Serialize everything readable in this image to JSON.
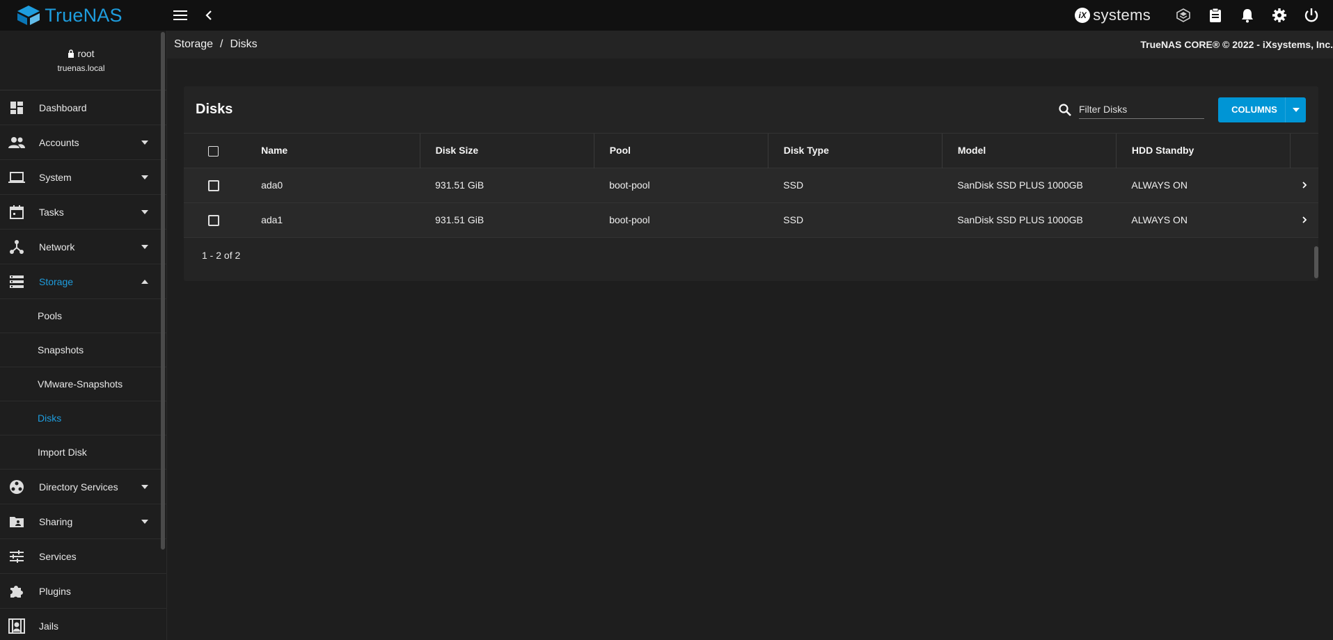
{
  "app": {
    "brand": "TrueNAS",
    "brand_sub": "CORE",
    "vendor": "systems",
    "vendor_badge": "iX"
  },
  "user": {
    "name": "root",
    "host": "truenas.local"
  },
  "sidebar": {
    "items": [
      {
        "label": "Dashboard",
        "icon": "dashboard-icon"
      },
      {
        "label": "Accounts",
        "icon": "accounts-icon"
      },
      {
        "label": "System",
        "icon": "laptop-icon"
      },
      {
        "label": "Tasks",
        "icon": "calendar-icon"
      },
      {
        "label": "Network",
        "icon": "network-icon"
      },
      {
        "label": "Storage",
        "icon": "storage-icon"
      }
    ],
    "storage_sub": [
      "Pools",
      "Snapshots",
      "VMware-Snapshots",
      "Disks",
      "Import Disk"
    ],
    "items_after": [
      {
        "label": "Directory Services",
        "icon": "directory-services-icon"
      },
      {
        "label": "Sharing",
        "icon": "sharing-folder-icon"
      },
      {
        "label": "Services",
        "icon": "tune-icon"
      },
      {
        "label": "Plugins",
        "icon": "puzzle-icon"
      },
      {
        "label": "Jails",
        "icon": "jail-icon"
      }
    ]
  },
  "breadcrumb": {
    "parent": "Storage",
    "separator": "/",
    "current": "Disks"
  },
  "copyright": "TrueNAS CORE® © 2022 - iXsystems, Inc.",
  "disks": {
    "title": "Disks",
    "filter_placeholder": "Filter Disks",
    "columns_label": "COLUMNS",
    "headers": [
      "Name",
      "Disk Size",
      "Pool",
      "Disk Type",
      "Model",
      "HDD Standby"
    ],
    "rows": [
      [
        "ada0",
        "931.51 GiB",
        "boot-pool",
        "SSD",
        "SanDisk SSD PLUS 1000GB",
        "ALWAYS ON"
      ],
      [
        "ada1",
        "931.51 GiB",
        "boot-pool",
        "SSD",
        "SanDisk SSD PLUS 1000GB",
        "ALWAYS ON"
      ]
    ],
    "pagination": "1 - 2 of 2"
  },
  "colors": {
    "accent": "#1e9dde",
    "button": "#0095d5",
    "bg": "#1e1e1e",
    "topbar": "#111111"
  }
}
